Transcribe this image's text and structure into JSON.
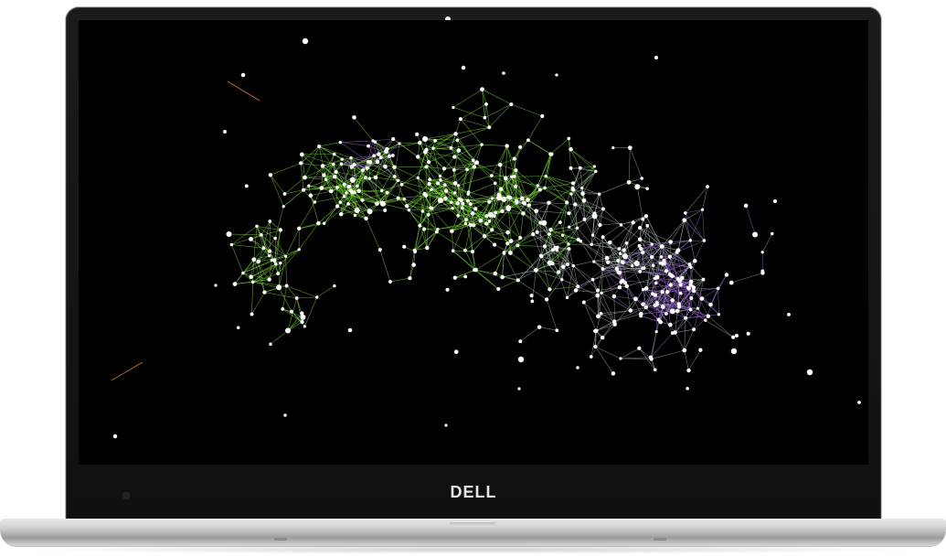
{
  "device": {
    "brand_logo": "DELL"
  },
  "screen": {
    "background_color": "#000000",
    "visualization": "network-graph",
    "palette": {
      "node": "#ffffff",
      "edge_green": "#7ddc3c",
      "edge_gray": "#9fb0a6",
      "edge_purple": "#9a6bd1",
      "edge_orange": "#d07a3a"
    }
  },
  "colors": {
    "bezel": "#151515",
    "chassis": "#c9c9c9"
  }
}
